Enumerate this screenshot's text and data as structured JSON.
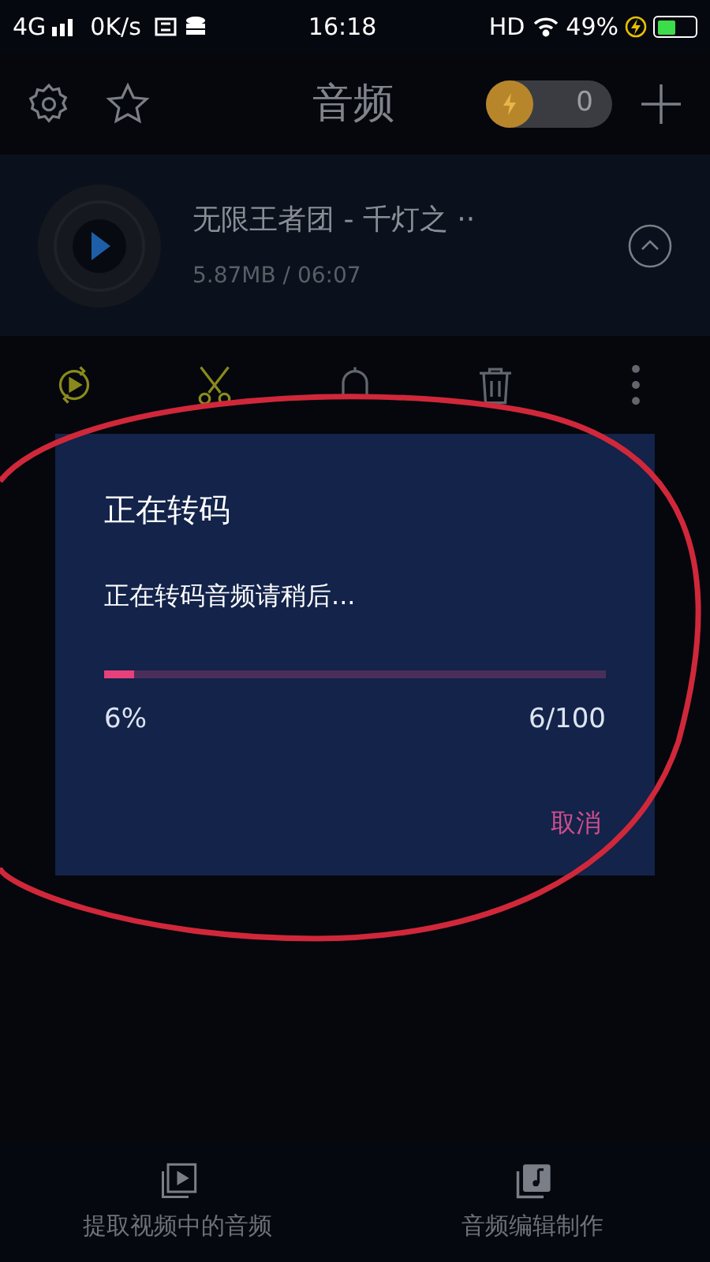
{
  "status_bar": {
    "network": "4G",
    "speed": "0K/s",
    "time": "16:18",
    "hd": "HD",
    "battery": "49%"
  },
  "header": {
    "title": "音频",
    "coin_count": "0"
  },
  "song": {
    "title": "无限王者团 - 千灯之 ··",
    "info": "5.87MB / 06:07"
  },
  "actions": [
    {
      "kind": "convert",
      "selected": true
    },
    {
      "kind": "cut",
      "selected": true
    },
    {
      "kind": "bell",
      "selected": false
    },
    {
      "kind": "trash",
      "selected": false
    },
    {
      "kind": "more",
      "selected": false
    }
  ],
  "dialog": {
    "title": "正在转码",
    "message": "正在转码音频请稍后...",
    "level": 0.06,
    "percent": "6%",
    "count": "6/100",
    "cancel": "取消"
  },
  "bottom_nav": [
    {
      "kind": "video",
      "label": "提取视频中的音频"
    },
    {
      "kind": "music",
      "label": "音频编辑制作"
    }
  ]
}
